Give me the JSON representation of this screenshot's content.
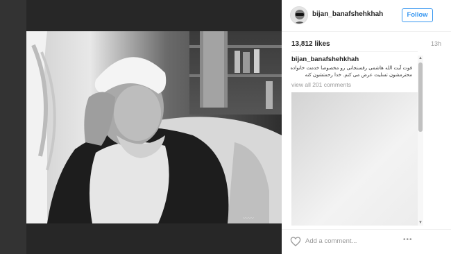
{
  "post": {
    "username": "bijan_banafshehkhah",
    "follow_label": "Follow",
    "likes": "13,812 likes",
    "time": "13h",
    "caption_user": "bijan_banafshehkhah",
    "caption_text": "فوت آیت الله هاشمی رفسنجانی رو مخصوصا خدمت خانواده محترمشون تسلیت عرض می کنم. خدا رحمتشون کنه",
    "view_all": "view all 201 comments",
    "add_comment_placeholder": "Add a comment...",
    "more_label": "•••"
  },
  "icons": {
    "avatar": "avatar-icon",
    "heart": "heart-icon",
    "more": "more-options-icon",
    "scroll_up": "arrow-up-icon",
    "scroll_down": "arrow-down-icon"
  },
  "colors": {
    "accent": "#3897f0",
    "muted": "#999999",
    "text": "#262626"
  }
}
